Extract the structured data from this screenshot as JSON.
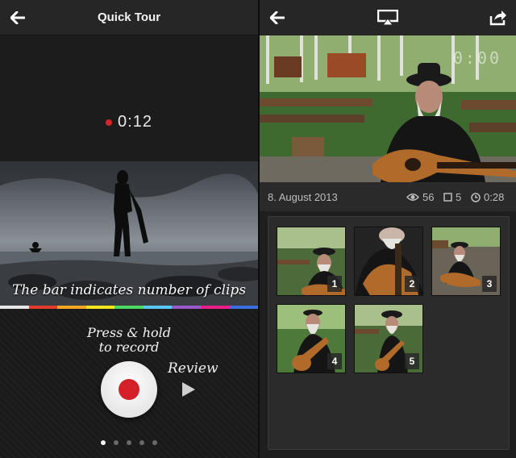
{
  "left_screen": {
    "header": {
      "title": "Quick Tour"
    },
    "timer": "0:12",
    "caption": "The bar indicates number of clips",
    "clip_colors": [
      "#e8e8e8",
      "#e33b2e",
      "#f5a623",
      "#f8e71c",
      "#4cd964",
      "#5ac8fa",
      "#9b59d0",
      "#e91e8c",
      "#3b6fe0"
    ],
    "press_hold_line1": "Press & hold",
    "press_hold_line2": "to record",
    "review_label": "Review",
    "pagination": {
      "count": 5,
      "active": 1
    }
  },
  "right_screen": {
    "video_time": "0:00",
    "info": {
      "date": "8. August 2013",
      "views": "56",
      "clips": "5",
      "duration": "0:28"
    },
    "thumbnails": [
      {
        "number": "1"
      },
      {
        "number": "2"
      },
      {
        "number": "3"
      },
      {
        "number": "4"
      },
      {
        "number": "5"
      }
    ]
  },
  "colors": {
    "accent_red": "#d5202a",
    "bar_bg": "#262626",
    "text_light": "#f2f2f2"
  }
}
